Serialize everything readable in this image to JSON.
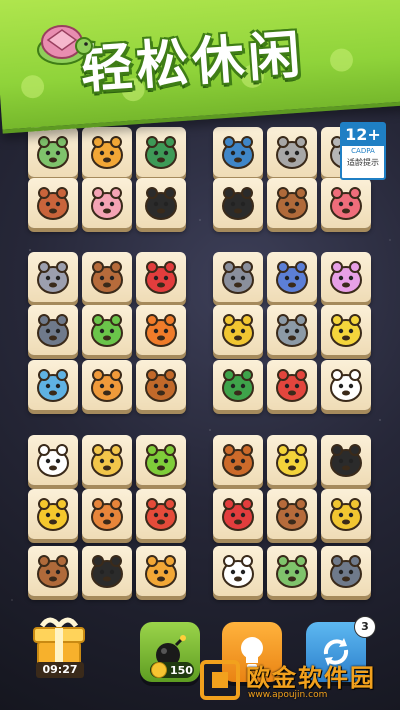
{
  "banner": {
    "title": "轻松休闲"
  },
  "age_rating": {
    "number": "12+",
    "org": "CADPA",
    "label": "适龄提示"
  },
  "tiles": [
    {
      "animal": "turtle",
      "color": "#7fc36c"
    },
    {
      "animal": "tiger",
      "color": "#f2a736"
    },
    {
      "animal": "snake",
      "color": "#3e9a57"
    },
    {
      "animal": "fish",
      "color": "#3f86c8"
    },
    {
      "animal": "raccoon",
      "color": "#a7a7a7"
    },
    {
      "animal": "cat-gray",
      "color": "#b5b5b5"
    },
    {
      "animal": "hedgehog",
      "color": "#c9643b"
    },
    {
      "animal": "pig",
      "color": "#f4a3b4"
    },
    {
      "animal": "penguin",
      "color": "#2b2b2b"
    },
    {
      "animal": "panda",
      "color": "#2b2b2b"
    },
    {
      "animal": "owl",
      "color": "#b06a3a"
    },
    {
      "animal": "octopus",
      "color": "#ef6d7b"
    },
    {
      "animal": "mouse",
      "color": "#9c9fae"
    },
    {
      "animal": "monkey",
      "color": "#b66b3b"
    },
    {
      "animal": "parrot",
      "color": "#e23d3d"
    },
    {
      "animal": "koala",
      "color": "#8a8f9c"
    },
    {
      "animal": "cat-blue",
      "color": "#5c7fd6"
    },
    {
      "animal": "jellyfish",
      "color": "#e7a0e6"
    },
    {
      "animal": "wolf",
      "color": "#6f7a8b"
    },
    {
      "animal": "frog",
      "color": "#6ac54a"
    },
    {
      "animal": "fox",
      "color": "#f07c2a"
    },
    {
      "animal": "angelfish",
      "color": "#f1c631"
    },
    {
      "animal": "elephant",
      "color": "#8c9aa6"
    },
    {
      "animal": "duck",
      "color": "#f4d53c"
    },
    {
      "animal": "dolphin",
      "color": "#5fb2e3"
    },
    {
      "animal": "corgi",
      "color": "#f09a3a"
    },
    {
      "animal": "deer",
      "color": "#c2692a"
    },
    {
      "animal": "crocodile",
      "color": "#3ea34a"
    },
    {
      "animal": "crab",
      "color": "#e3453d"
    },
    {
      "animal": "cow",
      "color": "#ffffff"
    },
    {
      "animal": "chicken",
      "color": "#ffffff"
    },
    {
      "animal": "leopard",
      "color": "#f2c64a"
    },
    {
      "animal": "caterpillar",
      "color": "#7fcd3a"
    },
    {
      "animal": "squirrel",
      "color": "#cc6a2a"
    },
    {
      "animal": "butterfly",
      "color": "#f3d33a"
    },
    {
      "animal": "toucan",
      "color": "#2b2b2b"
    },
    {
      "animal": "bee",
      "color": "#f5c82d"
    },
    {
      "animal": "shiba",
      "color": "#e7853a"
    },
    {
      "animal": "bird-red",
      "color": "#e44b3a"
    },
    {
      "animal": "parrot",
      "color": "#e23d3d"
    },
    {
      "animal": "monkey",
      "color": "#b66b3b"
    },
    {
      "animal": "angelfish",
      "color": "#f1c631"
    },
    {
      "animal": "owl",
      "color": "#b06a3a"
    },
    {
      "animal": "penguin",
      "color": "#2b2b2b"
    },
    {
      "animal": "tiger",
      "color": "#f2a736"
    },
    {
      "animal": "rabbit",
      "color": "#ffffff"
    },
    {
      "animal": "turtle",
      "color": "#7fc36c"
    },
    {
      "animal": "wolf",
      "color": "#6f7a8b"
    }
  ],
  "gift": {
    "timer": "09:27"
  },
  "powerups": {
    "bomb": {
      "cost": "150",
      "icon": "bomb-icon"
    },
    "hint": {
      "icon": "lightbulb-icon"
    },
    "shuffle": {
      "count": "3",
      "icon": "shuffle-icon"
    }
  },
  "watermark": {
    "text": "欧金软件园",
    "url": "www.apoujin.com"
  }
}
